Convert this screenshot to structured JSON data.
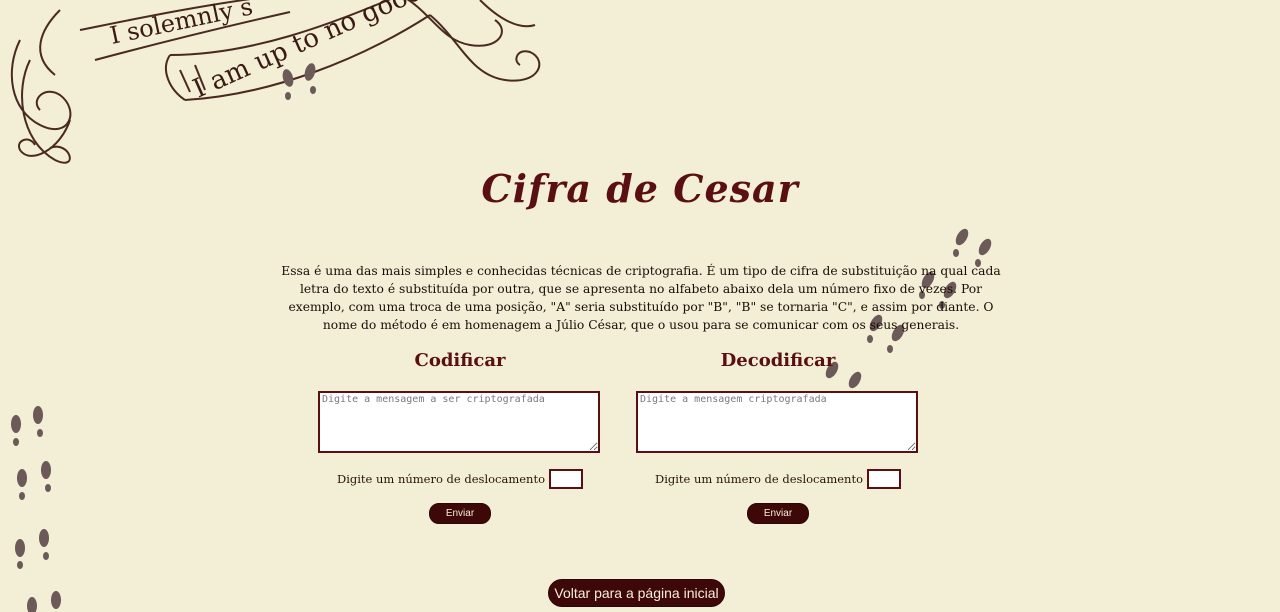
{
  "banner": {
    "line1": "I solemnly s",
    "line2": "I am up to no good."
  },
  "page": {
    "title": "Cifra de Cesar",
    "intro": "Essa é uma das mais simples e conhecidas técnicas de criptografia. É um tipo de cifra de substituição na qual cada letra do texto é substituída por outra, que se apresenta no alfabeto abaixo dela um número fixo de vezes. Por exemplo, com uma troca de uma posição, \"A\" seria substituído por \"B\", \"B\" se tornaria \"C\", e assim por diante. O nome do método é em homenagem a Júlio César, que o usou para se comunicar com os seus generais."
  },
  "encode": {
    "heading": "Codificar",
    "placeholder": "Digite a mensagem a ser criptografada",
    "shift_label": "Digite um número de deslocamento",
    "button": "Enviar"
  },
  "decode": {
    "heading": "Decodificar",
    "placeholder": "Digite a mensagem criptografada",
    "shift_label": "Digite um número de deslocamento",
    "button": "Enviar"
  },
  "footer": {
    "home_button": "Voltar para a página inicial"
  },
  "colors": {
    "background": "#f3eed6",
    "accent": "#5a0f12",
    "button_bg": "#3e0708"
  },
  "icons": {
    "banner": "marauders-map-banner-icon",
    "footprints": "footprints-icon"
  }
}
